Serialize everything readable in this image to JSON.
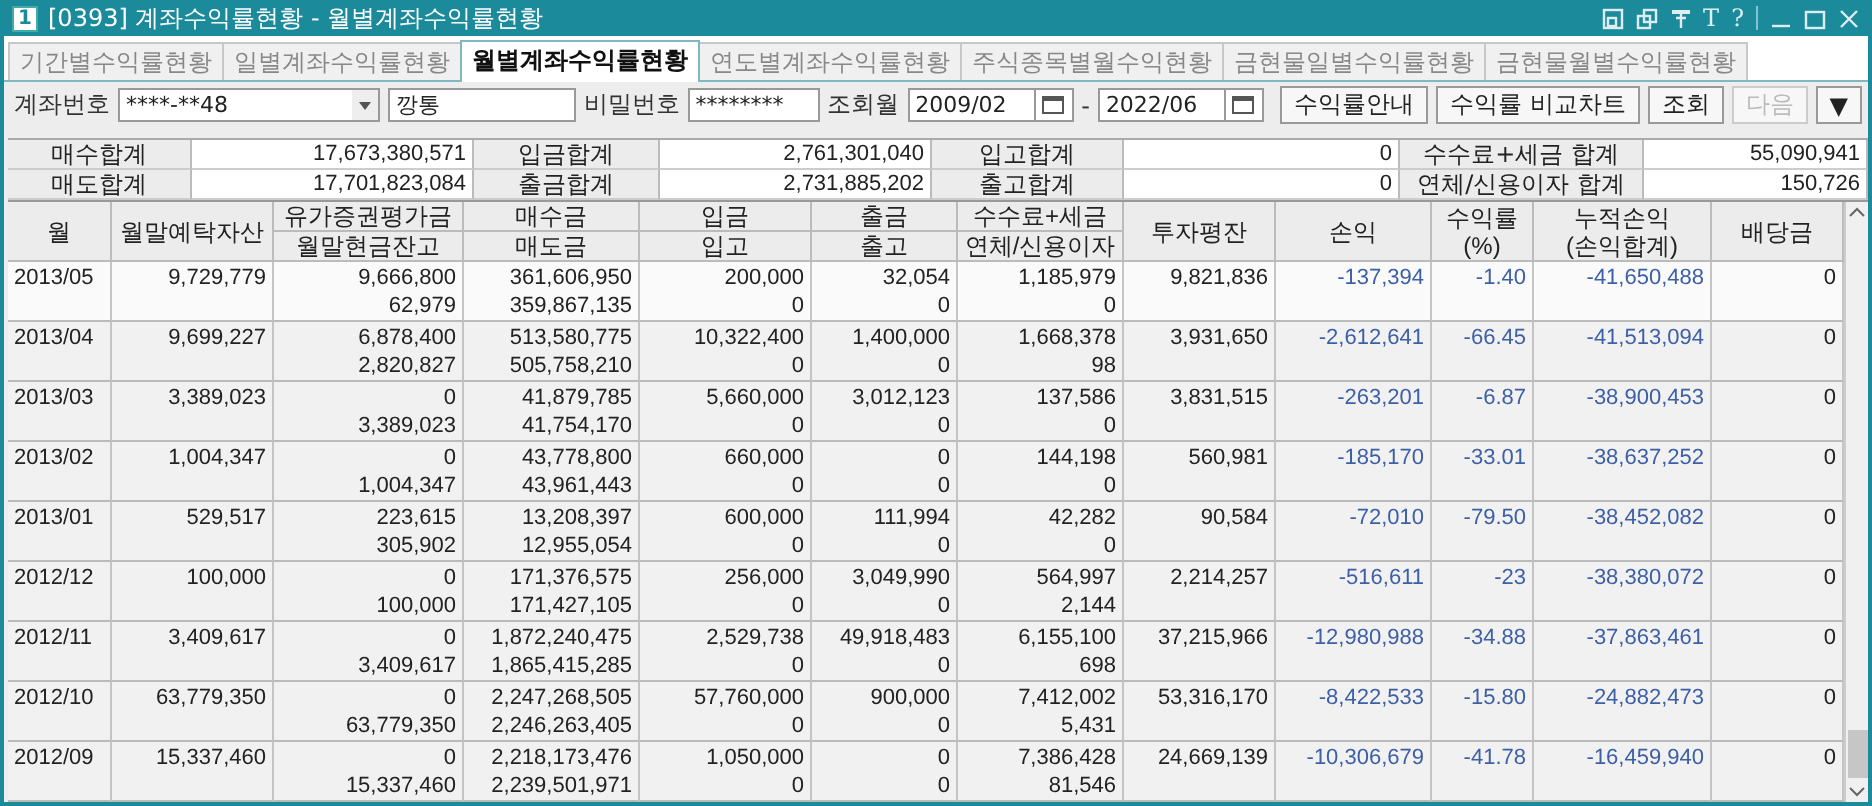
{
  "window": {
    "badge": "1",
    "title": "[0393] 계좌수익률현황 - 월별계좌수익률현황",
    "tools": [
      "T",
      "?"
    ]
  },
  "tabs": [
    {
      "label": "기간별수익률현황",
      "selected": false
    },
    {
      "label": "일별계좌수익률현황",
      "selected": false
    },
    {
      "label": "월별계좌수익률현황",
      "selected": true
    },
    {
      "label": "연도별계좌수익률현황",
      "selected": false
    },
    {
      "label": "주식종목별월수익현황",
      "selected": false
    },
    {
      "label": "금현물일별수익률현황",
      "selected": false
    },
    {
      "label": "금현물월별수익률현황",
      "selected": false
    }
  ],
  "query": {
    "account_label": "계좌번호",
    "account": "****-**48",
    "account_name": "깡통",
    "password_label": "비밀번호",
    "password": "********",
    "month_label": "조회월",
    "from": "2009/02",
    "separator": "-",
    "to": "2022/06",
    "buttons": [
      {
        "label": "수익률안내",
        "disabled": false
      },
      {
        "label": "수익률 비교차트",
        "disabled": false
      },
      {
        "label": "조회",
        "disabled": false
      },
      {
        "label": "다음",
        "disabled": true
      },
      {
        "label": "▼",
        "disabled": false
      }
    ]
  },
  "summary": [
    [
      {
        "label": "매수합계",
        "value": "17,673,380,571"
      },
      {
        "label": "입금합계",
        "value": "2,761,301,040"
      },
      {
        "label": "입고합계",
        "value": "0"
      },
      {
        "label": "수수료+세금 합계",
        "value": "55,090,941"
      }
    ],
    [
      {
        "label": "매도합계",
        "value": "17,701,823,084"
      },
      {
        "label": "출금합계",
        "value": "2,731,885,202"
      },
      {
        "label": "출고합계",
        "value": "0"
      },
      {
        "label": "연체/신용이자 합계",
        "value": "150,726"
      }
    ]
  ],
  "table": {
    "columns": [
      {
        "kind": "single",
        "label": "월"
      },
      {
        "kind": "single",
        "label": "월말예탁자산"
      },
      {
        "kind": "split",
        "top": "유가증권평가금",
        "bottom": "월말현금잔고"
      },
      {
        "kind": "split",
        "top": "매수금",
        "bottom": "매도금"
      },
      {
        "kind": "split",
        "top": "입금",
        "bottom": "입고"
      },
      {
        "kind": "split",
        "top": "출금",
        "bottom": "출고"
      },
      {
        "kind": "split",
        "top": "수수료+세금",
        "bottom": "연체/신용이자"
      },
      {
        "kind": "single",
        "label": "투자평잔"
      },
      {
        "kind": "single",
        "label": "손익"
      },
      {
        "kind": "single",
        "label": "수익률\n(%)"
      },
      {
        "kind": "single",
        "label": "누적손익\n(손익합계)"
      },
      {
        "kind": "single",
        "label": "배당금"
      }
    ],
    "rows": [
      [
        [
          "2013/05"
        ],
        [
          "9,729,779"
        ],
        [
          "9,666,800",
          "62,979"
        ],
        [
          "361,606,950",
          "359,867,135"
        ],
        [
          "200,000",
          "0"
        ],
        [
          "32,054",
          "0"
        ],
        [
          "1,185,979",
          "0"
        ],
        [
          "9,821,836"
        ],
        [
          "-137,394"
        ],
        [
          "-1.40"
        ],
        [
          "-41,650,488"
        ],
        [
          "0"
        ]
      ],
      [
        [
          "2013/04"
        ],
        [
          "9,699,227"
        ],
        [
          "6,878,400",
          "2,820,827"
        ],
        [
          "513,580,775",
          "505,758,210"
        ],
        [
          "10,322,400",
          "0"
        ],
        [
          "1,400,000",
          "0"
        ],
        [
          "1,668,378",
          "98"
        ],
        [
          "3,931,650"
        ],
        [
          "-2,612,641"
        ],
        [
          "-66.45"
        ],
        [
          "-41,513,094"
        ],
        [
          "0"
        ]
      ],
      [
        [
          "2013/03"
        ],
        [
          "3,389,023"
        ],
        [
          "0",
          "3,389,023"
        ],
        [
          "41,879,785",
          "41,754,170"
        ],
        [
          "5,660,000",
          "0"
        ],
        [
          "3,012,123",
          "0"
        ],
        [
          "137,586",
          "0"
        ],
        [
          "3,831,515"
        ],
        [
          "-263,201"
        ],
        [
          "-6.87"
        ],
        [
          "-38,900,453"
        ],
        [
          "0"
        ]
      ],
      [
        [
          "2013/02"
        ],
        [
          "1,004,347"
        ],
        [
          "0",
          "1,004,347"
        ],
        [
          "43,778,800",
          "43,961,443"
        ],
        [
          "660,000",
          "0"
        ],
        [
          "0",
          "0"
        ],
        [
          "144,198",
          "0"
        ],
        [
          "560,981"
        ],
        [
          "-185,170"
        ],
        [
          "-33.01"
        ],
        [
          "-38,637,252"
        ],
        [
          "0"
        ]
      ],
      [
        [
          "2013/01"
        ],
        [
          "529,517"
        ],
        [
          "223,615",
          "305,902"
        ],
        [
          "13,208,397",
          "12,955,054"
        ],
        [
          "600,000",
          "0"
        ],
        [
          "111,994",
          "0"
        ],
        [
          "42,282",
          "0"
        ],
        [
          "90,584"
        ],
        [
          "-72,010"
        ],
        [
          "-79.50"
        ],
        [
          "-38,452,082"
        ],
        [
          "0"
        ]
      ],
      [
        [
          "2012/12"
        ],
        [
          "100,000"
        ],
        [
          "0",
          "100,000"
        ],
        [
          "171,376,575",
          "171,427,105"
        ],
        [
          "256,000",
          "0"
        ],
        [
          "3,049,990",
          "0"
        ],
        [
          "564,997",
          "2,144"
        ],
        [
          "2,214,257"
        ],
        [
          "-516,611"
        ],
        [
          "-23"
        ],
        [
          "-38,380,072"
        ],
        [
          "0"
        ]
      ],
      [
        [
          "2012/11"
        ],
        [
          "3,409,617"
        ],
        [
          "0",
          "3,409,617"
        ],
        [
          "1,872,240,475",
          "1,865,415,285"
        ],
        [
          "2,529,738",
          "0"
        ],
        [
          "49,918,483",
          "0"
        ],
        [
          "6,155,100",
          "698"
        ],
        [
          "37,215,966"
        ],
        [
          "-12,980,988"
        ],
        [
          "-34.88"
        ],
        [
          "-37,863,461"
        ],
        [
          "0"
        ]
      ],
      [
        [
          "2012/10"
        ],
        [
          "63,779,350"
        ],
        [
          "0",
          "63,779,350"
        ],
        [
          "2,247,268,505",
          "2,246,263,405"
        ],
        [
          "57,760,000",
          "0"
        ],
        [
          "900,000",
          "0"
        ],
        [
          "7,412,002",
          "5,431"
        ],
        [
          "53,316,170"
        ],
        [
          "-8,422,533"
        ],
        [
          "-15.80"
        ],
        [
          "-24,882,473"
        ],
        [
          "0"
        ]
      ],
      [
        [
          "2012/09"
        ],
        [
          "15,337,460"
        ],
        [
          "0",
          "15,337,460"
        ],
        [
          "2,218,173,476",
          "2,239,501,971"
        ],
        [
          "1,050,000",
          "0"
        ],
        [
          "0",
          "0"
        ],
        [
          "7,386,428",
          "81,546"
        ],
        [
          "24,669,139"
        ],
        [
          "-10,306,679"
        ],
        [
          "-41.78"
        ],
        [
          "-16,459,940"
        ],
        [
          "0"
        ]
      ]
    ]
  }
}
